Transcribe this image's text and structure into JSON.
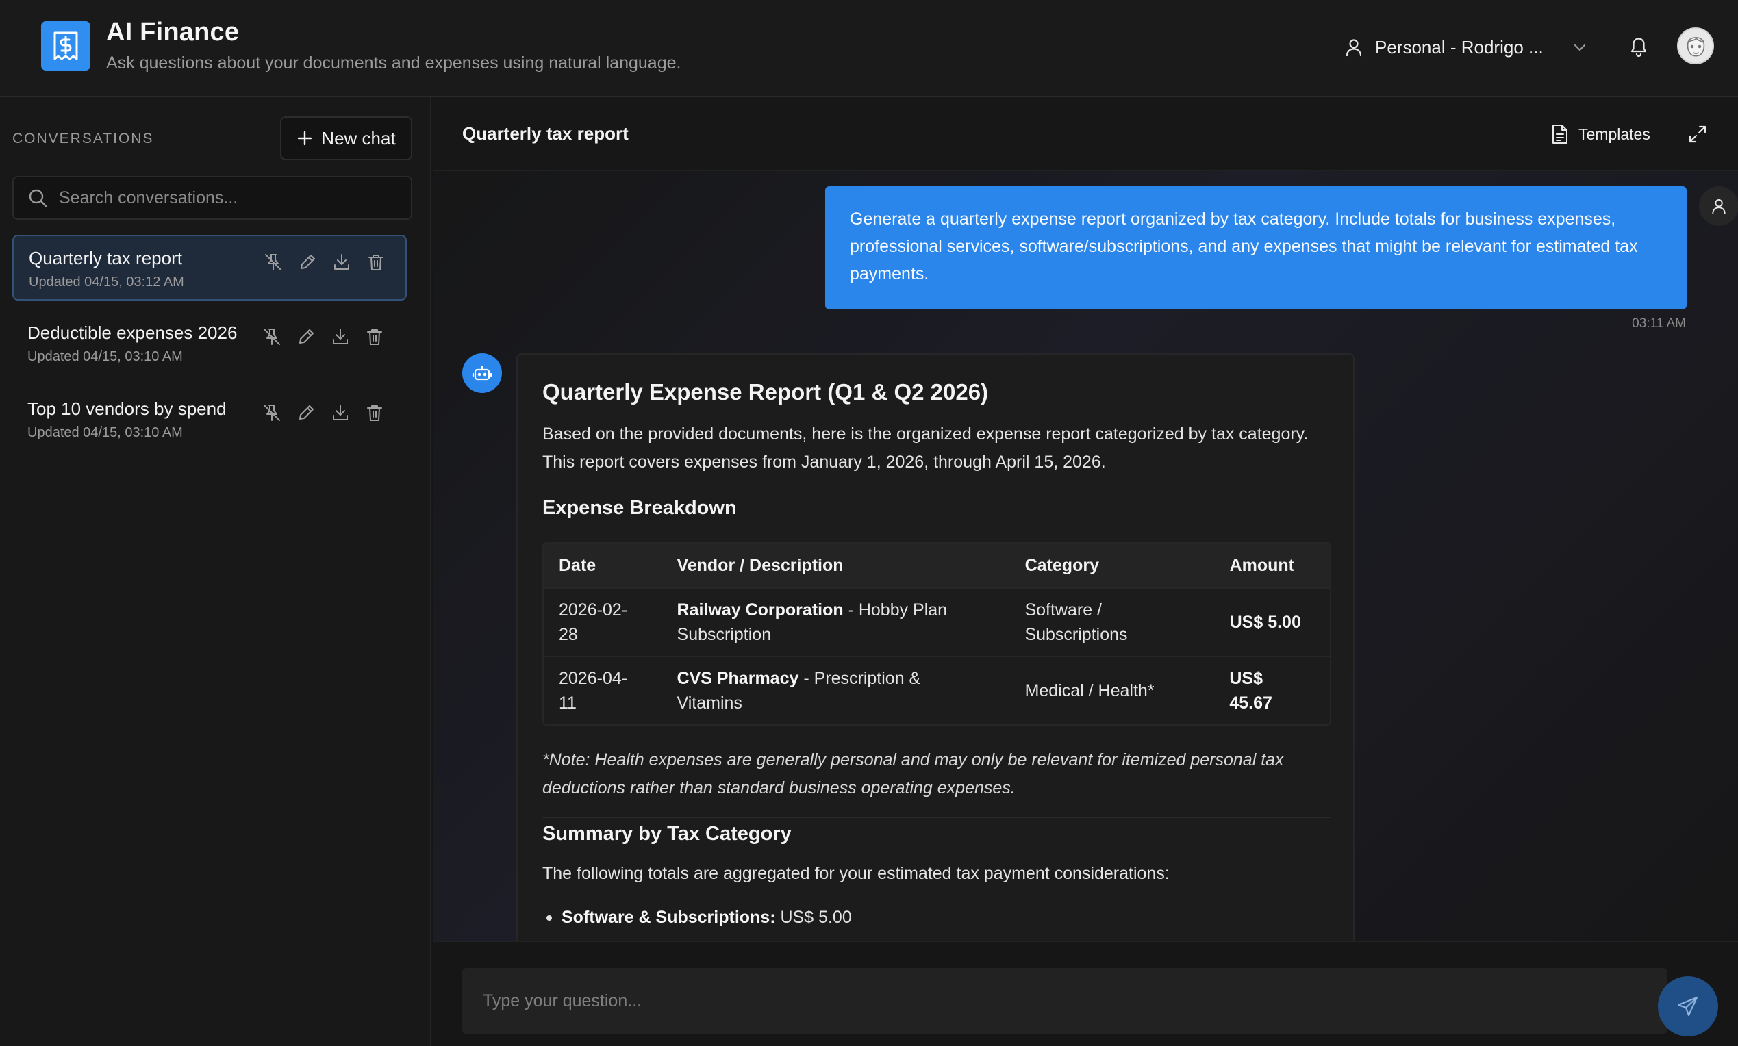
{
  "app": {
    "title": "AI Finance",
    "subtitle": "Ask questions about your documents and expenses using natural language."
  },
  "header": {
    "account_label": "Personal - Rodrigo ...",
    "icons": [
      "receipt-dollar-icon",
      "user-icon",
      "chevron-down-icon",
      "bell-icon",
      "avatar"
    ]
  },
  "sidebar": {
    "heading": "CONVERSATIONS",
    "new_chat_label": "New chat",
    "search_placeholder": "Search conversations...",
    "items": [
      {
        "title": "Quarterly tax report",
        "updated": "Updated 04/15, 03:12 AM",
        "active": true
      },
      {
        "title": "Deductible expenses 2026",
        "updated": "Updated 04/15, 03:10 AM",
        "active": false
      },
      {
        "title": "Top 10 vendors by spend",
        "updated": "Updated 04/15, 03:10 AM",
        "active": false
      }
    ]
  },
  "chat": {
    "title": "Quarterly tax report",
    "templates_label": "Templates",
    "user_message": "Generate a quarterly expense report organized by tax category. Include totals for business expenses, professional services, software/subscriptions, and any expenses that might be relevant for estimated tax payments.",
    "user_time": "03:11 AM",
    "reply": {
      "title": "Quarterly Expense Report (Q1 & Q2 2026)",
      "intro": "Based on the provided documents, here is the organized expense report categorized by tax category. This report covers expenses from January 1, 2026, through April 15, 2026.",
      "breakdown_title": "Expense Breakdown",
      "table": {
        "headers": [
          "Date",
          "Vendor / Description",
          "Category",
          "Amount"
        ],
        "rows": [
          {
            "date": "2026-02-28",
            "vendor": "Railway Corporation",
            "description": " - Hobby Plan Subscription",
            "category": "Software / Subscriptions",
            "amount": "US$ 5.00"
          },
          {
            "date": "2026-04-11",
            "vendor": "CVS Pharmacy",
            "description": " - Prescription & Vitamins",
            "category": "Medical / Health*",
            "amount": "US$ 45.67"
          }
        ]
      },
      "note": "*Note: Health expenses are generally personal and may only be relevant for itemized personal tax deductions rather than standard business operating expenses.",
      "summary_title": "Summary by Tax Category",
      "summary_text": "The following totals are aggregated for your estimated tax payment considerations:",
      "summary_items": [
        {
          "label": "Software & Subscriptions:",
          "value": " US$ 5.00"
        }
      ]
    },
    "composer_placeholder": "Type your question..."
  },
  "colors": {
    "accent": "#2a86ea",
    "background": "#161616",
    "sidebar_active": "#1f2a3a"
  }
}
